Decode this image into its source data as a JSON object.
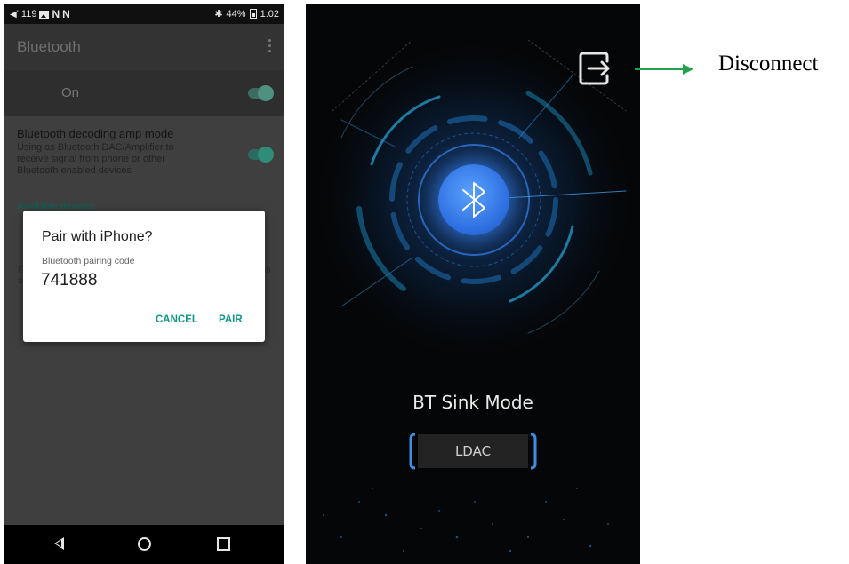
{
  "left_screen": {
    "status_bar": {
      "volume_icon": "volume-icon",
      "volume_level": "119",
      "icons": [
        "gallery-icon",
        "n-notification-icon",
        "n-notification-icon"
      ],
      "bluetooth_icon": "bluetooth-icon",
      "battery": "44%",
      "time": "1:02"
    },
    "app_bar": {
      "title": "Bluetooth",
      "menu_icon": "more-vert-icon"
    },
    "bluetooth_toggle": {
      "label": "On",
      "on": true
    },
    "amp_mode": {
      "title": "Bluetooth decoding amp mode",
      "description_lines": [
        "Using as Bluetooth DAC/Amplifier to",
        "receive signal from phone or other",
        "Bluetooth enabled devices"
      ],
      "on": true
    },
    "available_devices_label": "Available devices",
    "obscured_text": {
      "left_lines": [
        "F",
        "se"
      ],
      "right": "h"
    },
    "dialog": {
      "title": "Pair with iPhone?",
      "subtitle": "Bluetooth pairing code",
      "code": "741888",
      "cancel_label": "CANCEL",
      "pair_label": "PAIR"
    },
    "nav_bar": {
      "back_icon": "back-icon",
      "home_icon": "home-icon",
      "recents_icon": "recents-icon"
    }
  },
  "right_screen": {
    "disconnect_icon": "disconnect-icon",
    "bluetooth_icon": "bluetooth-icon",
    "mode_title": "BT Sink Mode",
    "codec": "LDAC"
  },
  "callout": {
    "label": "Disconnect",
    "color": "#22a04a"
  }
}
